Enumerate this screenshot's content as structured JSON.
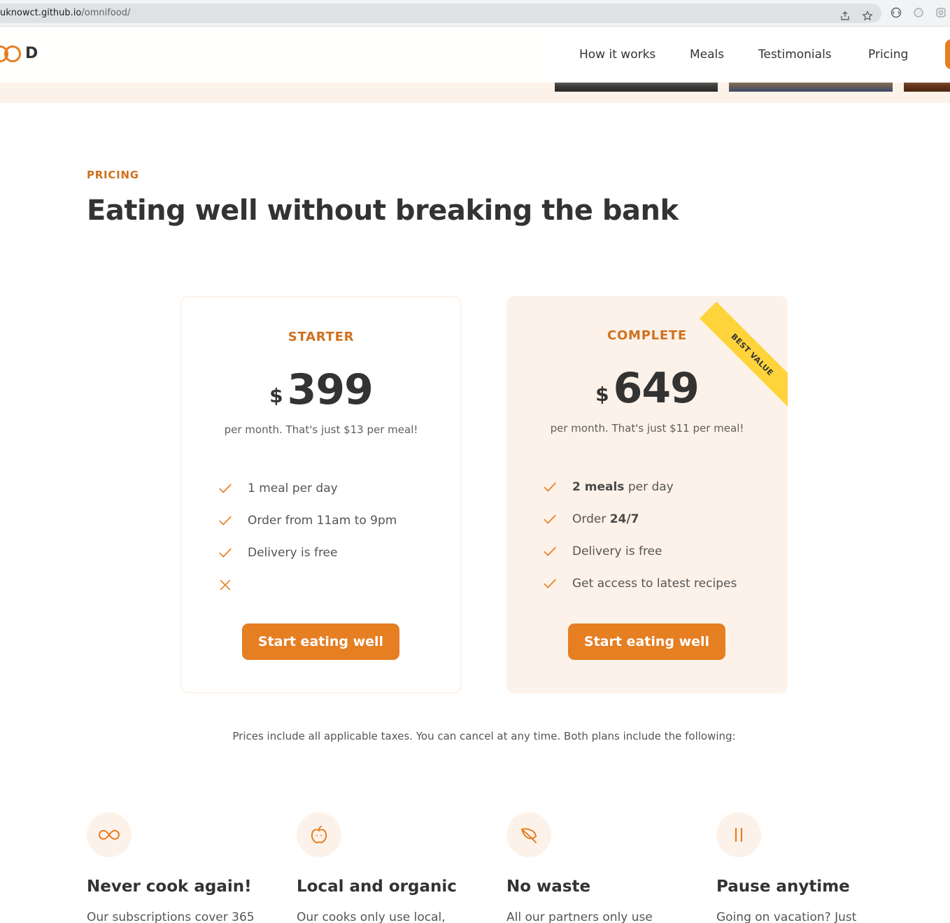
{
  "browser": {
    "url_host": "uknowct.github.io",
    "url_path": "/omnifood/"
  },
  "header": {
    "logo_text": "D",
    "nav": [
      {
        "label": "How it works"
      },
      {
        "label": "Meals"
      },
      {
        "label": "Testimonials"
      },
      {
        "label": "Pricing"
      }
    ]
  },
  "pricing": {
    "subheading": "PRICING",
    "heading": "Eating well without breaking the bank",
    "plans": [
      {
        "name": "STARTER",
        "currency": "$",
        "price": "399",
        "note": "per month. That's just $13 per meal!",
        "features": [
          {
            "icon": "check-icon",
            "text": "1 meal per day"
          },
          {
            "icon": "check-icon",
            "text": "Order from 11am to 9pm"
          },
          {
            "icon": "check-icon",
            "text": "Delivery is free"
          },
          {
            "icon": "close-icon",
            "text": ""
          }
        ],
        "button": "Start eating well"
      },
      {
        "name": "COMPLETE",
        "currency": "$",
        "price": "649",
        "note": "per month. That's just $11 per meal!",
        "ribbon": "BEST VALUE",
        "features": [
          {
            "icon": "check-icon",
            "strong": "2 meals",
            "text": " per day"
          },
          {
            "icon": "check-icon",
            "text": "Order ",
            "strong_after": "24/7"
          },
          {
            "icon": "check-icon",
            "text": "Delivery is free"
          },
          {
            "icon": "check-icon",
            "text": "Get access to latest recipes"
          }
        ],
        "button": "Start eating well"
      }
    ],
    "details": "Prices include all applicable taxes. You can cancel at any time. Both plans include the following:"
  },
  "features": [
    {
      "icon": "infinity-icon",
      "title": "Never cook again!",
      "desc": "Our subscriptions cover 365"
    },
    {
      "icon": "apple-icon",
      "title": "Local and organic",
      "desc": "Our cooks only use local,"
    },
    {
      "icon": "leaf-icon",
      "title": "No waste",
      "desc": "All our partners only use"
    },
    {
      "icon": "pause-icon",
      "title": "Pause anytime",
      "desc": "Going on vacation? Just"
    }
  ],
  "colors": {
    "brand": "#e67e22",
    "brand_dark": "#cf711f",
    "tint": "#fdf2e9",
    "ribbon": "#ffd43b",
    "heading": "#333333"
  }
}
